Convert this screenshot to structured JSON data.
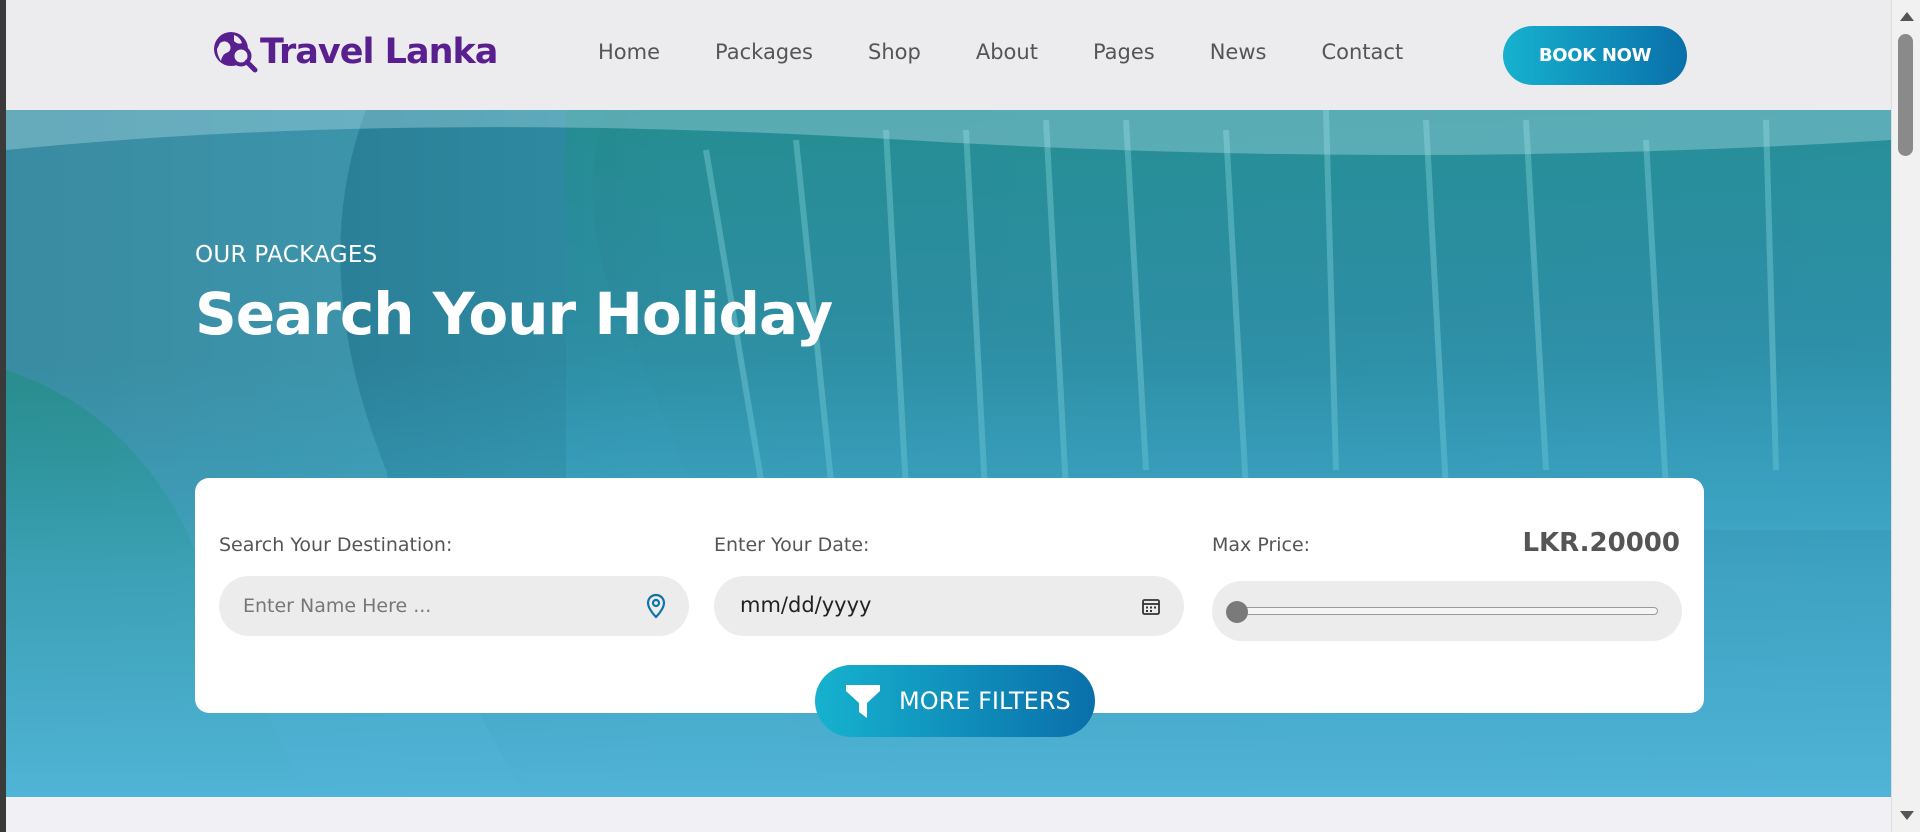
{
  "brand": {
    "name": "Travel Lanka",
    "icon": "globe-search-icon",
    "color": "#5a1f8f"
  },
  "nav": {
    "items": [
      {
        "label": "Home"
      },
      {
        "label": "Packages"
      },
      {
        "label": "Shop"
      },
      {
        "label": "About"
      },
      {
        "label": "Pages"
      },
      {
        "label": "News"
      },
      {
        "label": "Contact"
      }
    ],
    "cta_label": "BOOK NOW"
  },
  "hero": {
    "subtitle": "OUR PACKAGES",
    "title": "Search Your Holiday",
    "background": "waterfall-photo"
  },
  "search": {
    "destination": {
      "label": "Search Your Destination:",
      "placeholder": "Enter Name Here ...",
      "icon": "map-pin-icon"
    },
    "date": {
      "label": "Enter Your Date:",
      "value": "mm/dd/yyyy",
      "icon": "calendar-icon"
    },
    "price": {
      "label": "Max Price:",
      "value_label": "LKR.20000",
      "slider_fraction": 0.0
    },
    "more_filters_label": "MORE FILTERS",
    "more_filters_icon": "filter-icon"
  },
  "colors": {
    "accent_start": "#16b2cf",
    "accent_end": "#0a6fa9",
    "brand": "#5a1f8f"
  }
}
